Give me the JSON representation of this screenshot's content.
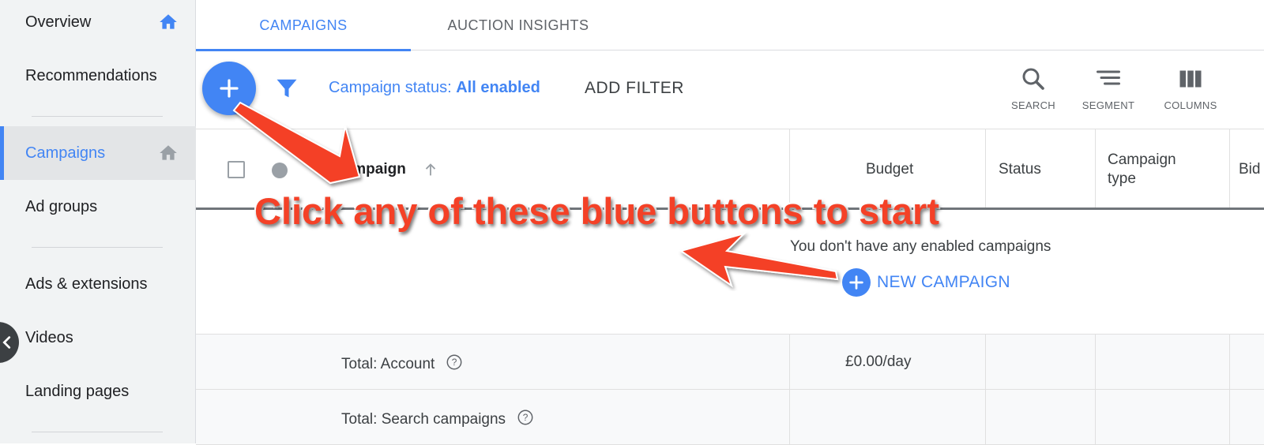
{
  "sidebar": {
    "items": [
      {
        "label": "Overview"
      },
      {
        "label": "Recommendations"
      },
      {
        "label": "Campaigns"
      },
      {
        "label": "Ad groups"
      },
      {
        "label": "Ads & extensions"
      },
      {
        "label": "Videos"
      },
      {
        "label": "Landing pages"
      }
    ],
    "active_item": "Campaigns"
  },
  "tabs": [
    {
      "label": "CAMPAIGNS",
      "active": true
    },
    {
      "label": "AUCTION INSIGHTS",
      "active": false
    }
  ],
  "toolbar": {
    "filter_prefix": "Campaign status: ",
    "filter_value": "All enabled",
    "add_filter": "ADD FILTER",
    "tools": [
      {
        "label": "SEARCH",
        "icon": "search-icon"
      },
      {
        "label": "SEGMENT",
        "icon": "segment-icon"
      },
      {
        "label": "COLUMNS",
        "icon": "columns-icon"
      }
    ]
  },
  "table": {
    "headers": {
      "campaign": "Campaign",
      "budget": "Budget",
      "status": "Status",
      "campaign_type_line1": "Campaign",
      "campaign_type_line2": "type",
      "bid": "Bid"
    },
    "empty_message": "You don't have any enabled campaigns",
    "new_campaign": "NEW CAMPAIGN",
    "totals": [
      {
        "label": "Total: Account",
        "budget": "£0.00/day"
      },
      {
        "label": "Total: Search campaigns",
        "budget": ""
      }
    ]
  },
  "annotation": {
    "text": "Click any of these blue buttons to start"
  },
  "colors": {
    "accent": "#4285f4",
    "annotation": "#f44127",
    "sidebar_bg": "#f1f3f4"
  }
}
